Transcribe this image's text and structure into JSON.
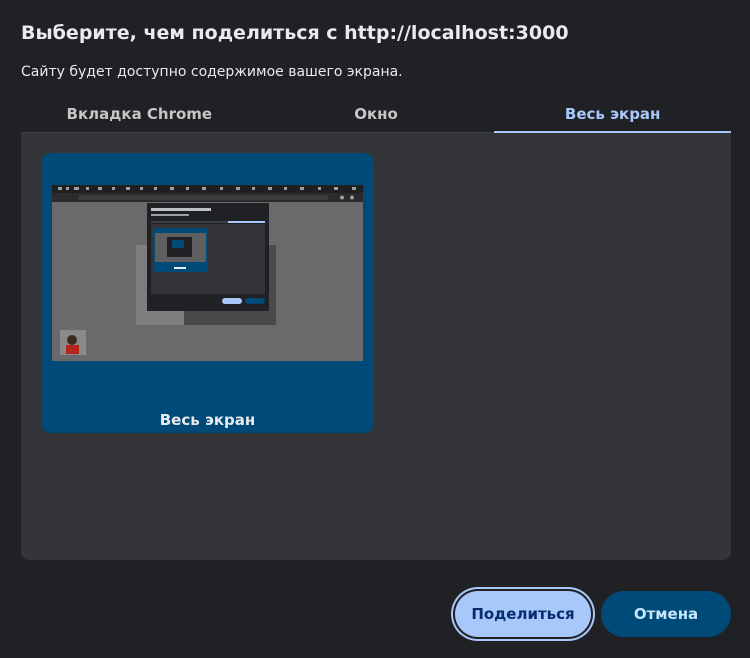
{
  "dialog": {
    "title": "Выберите, чем поделиться с http://localhost:3000",
    "subtitle": "Сайту будет доступно содержимое вашего экрана."
  },
  "tabs": [
    {
      "label": "Вкладка Chrome",
      "active": false
    },
    {
      "label": "Окно",
      "active": false
    },
    {
      "label": "Весь экран",
      "active": true
    }
  ],
  "screens": [
    {
      "label": "Весь экран",
      "selected": true
    }
  ],
  "buttons": {
    "share": "Поделиться",
    "cancel": "Отмена"
  },
  "colors": {
    "background": "#202124",
    "panel": "#333438",
    "accent": "#a8c7fa",
    "card_selected": "#004a77"
  }
}
